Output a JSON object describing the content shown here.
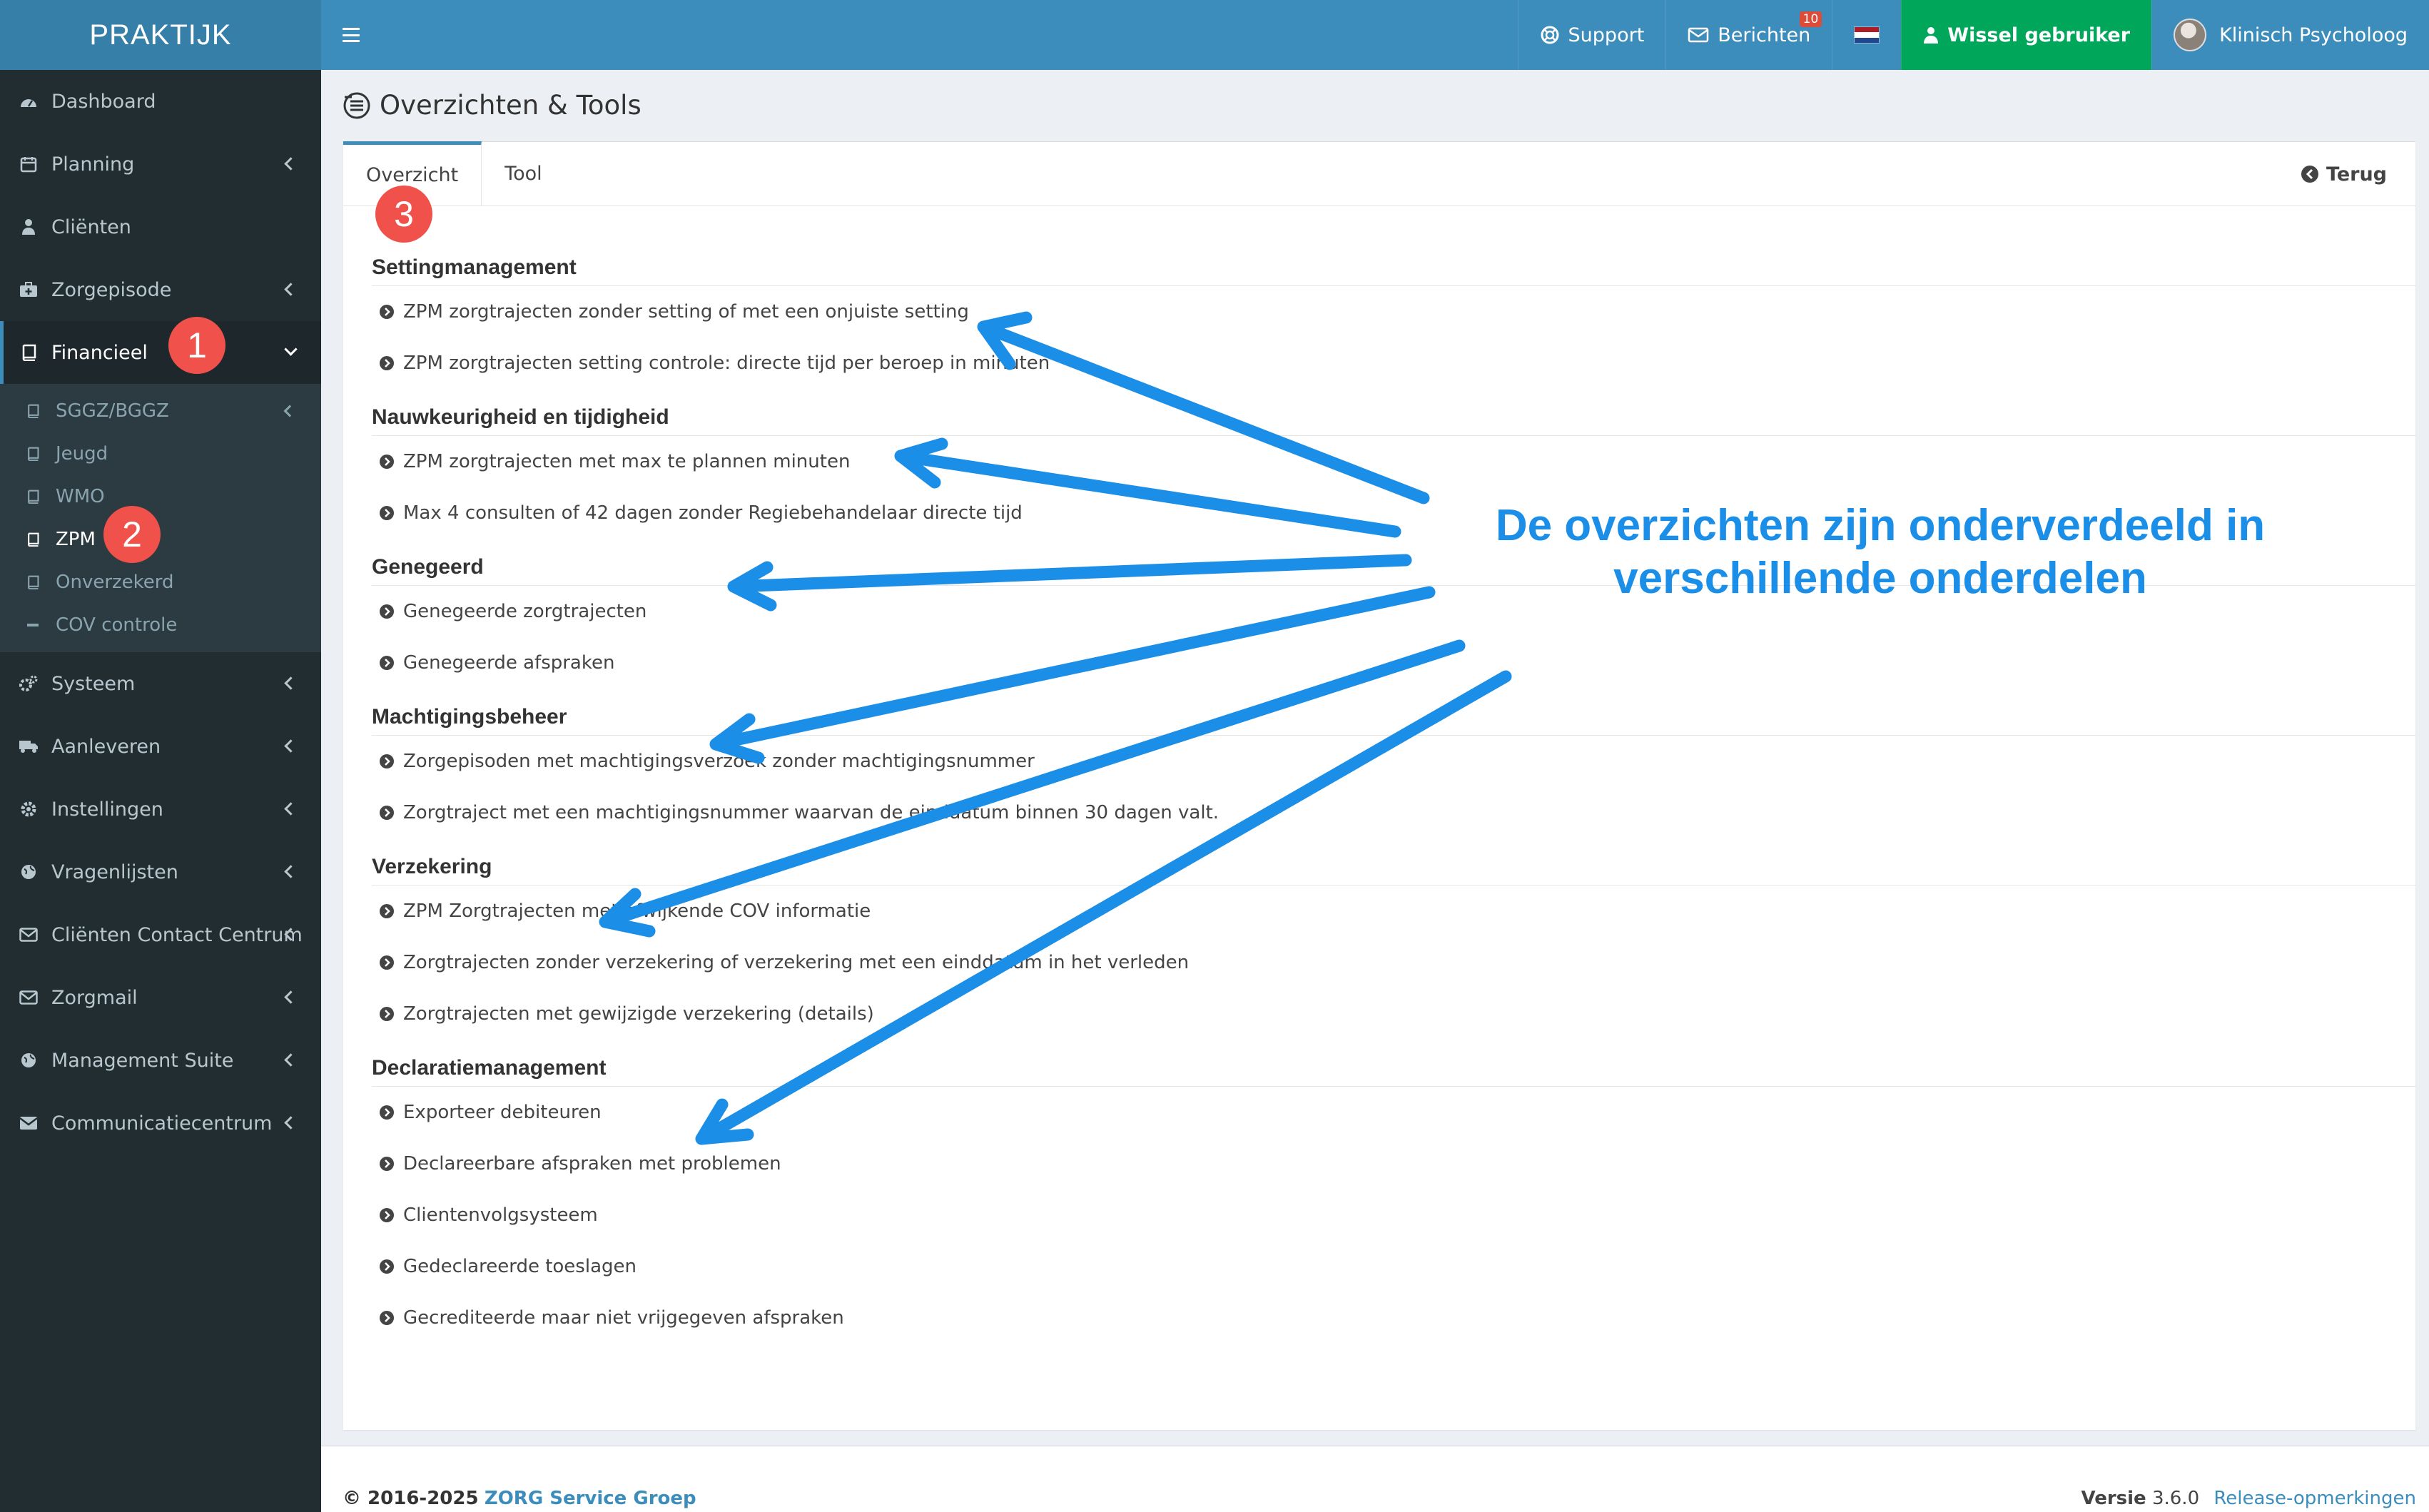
{
  "app": {
    "logo": "PRAKTIJK"
  },
  "topbar": {
    "support": "Support",
    "berichten": "Berichten",
    "berichten_count": "10",
    "switch_user": "Wissel gebruiker",
    "user_name": "Klinisch Psycholoog"
  },
  "sidebar": {
    "items_top": [
      {
        "label": "Dashboard",
        "icon": "dashboard-icon"
      },
      {
        "label": "Planning",
        "icon": "calendar-icon"
      },
      {
        "label": "Cliënten",
        "icon": "user-icon"
      },
      {
        "label": "Zorgepisode",
        "icon": "medkit-icon"
      },
      {
        "label": "Financieel",
        "icon": "book-icon"
      }
    ],
    "sub_items": [
      {
        "label": "SGGZ/BGGZ",
        "icon": "book-icon"
      },
      {
        "label": "Jeugd",
        "icon": "book-icon"
      },
      {
        "label": "WMO",
        "icon": "book-icon"
      },
      {
        "label": "ZPM",
        "icon": "book-icon"
      },
      {
        "label": "Onverzekerd",
        "icon": "book-icon"
      },
      {
        "label": "COV controle",
        "icon": "minus-icon"
      }
    ],
    "items_bottom": [
      {
        "label": "Systeem",
        "icon": "cogs-icon"
      },
      {
        "label": "Aanleveren",
        "icon": "truck-icon"
      },
      {
        "label": "Instellingen",
        "icon": "gear-icon"
      },
      {
        "label": "Vragenlijsten",
        "icon": "globe-icon"
      },
      {
        "label": "Cliënten Contact Centrum",
        "icon": "envelope-icon"
      },
      {
        "label": "Zorgmail",
        "icon": "envelope-icon"
      },
      {
        "label": "Management Suite",
        "icon": "globe-icon"
      },
      {
        "label": "Communicatiecentrum",
        "icon": "envelope-icon"
      }
    ]
  },
  "markers": {
    "one": "1",
    "two": "2",
    "three": "3"
  },
  "page": {
    "title": "Overzichten & Tools",
    "tabs": [
      "Overzicht",
      "Tool"
    ],
    "back": "Terug"
  },
  "sections": [
    {
      "title": "Settingmanagement",
      "items": [
        "ZPM zorgtrajecten zonder setting of met een onjuiste setting",
        "ZPM zorgtrajecten setting controle: directe tijd per beroep in minuten"
      ]
    },
    {
      "title": "Nauwkeurigheid en tijdigheid",
      "items": [
        "ZPM zorgtrajecten met max te plannen minuten",
        "Max 4 consulten of 42 dagen zonder Regiebehandelaar directe tijd"
      ]
    },
    {
      "title": "Genegeerd",
      "items": [
        "Genegeerde zorgtrajecten",
        "Genegeerde afspraken"
      ]
    },
    {
      "title": "Machtigingsbeheer",
      "items": [
        "Zorgepisoden met machtigingsverzoek zonder machtigingsnummer",
        "Zorgtraject met een machtigingsnummer waarvan de einddatum binnen 30 dagen valt."
      ]
    },
    {
      "title": "Verzekering",
      "items": [
        "ZPM Zorgtrajecten met afwijkende COV informatie",
        "Zorgtrajecten zonder verzekering of verzekering met een einddatum in het verleden",
        "Zorgtrajecten met gewijzigde verzekering (details)"
      ]
    },
    {
      "title": "Declaratiemanagement",
      "items": [
        "Exporteer debiteuren",
        "Declareerbare afspraken met problemen",
        "Clientenvolgsysteem",
        "Gedeclareerde toeslagen",
        "Gecrediteerde maar niet vrijgegeven afspraken"
      ]
    }
  ],
  "annotation": {
    "line1": "De overzichten zijn onderverdeeld in",
    "line2": "verschillende onderdelen",
    "color": "#1b8ee8"
  },
  "footer": {
    "copyright": "© 2016-2025",
    "company": "ZORG Service Groep",
    "version_label": "Versie",
    "version": "3.6.0",
    "release_notes": "Release-opmerkingen"
  },
  "colors": {
    "header": "#3c8dbc",
    "logo_bg": "#367fa9",
    "sidebar": "#222d32",
    "switch_user": "#00a65a",
    "marker": "#f0524b"
  }
}
